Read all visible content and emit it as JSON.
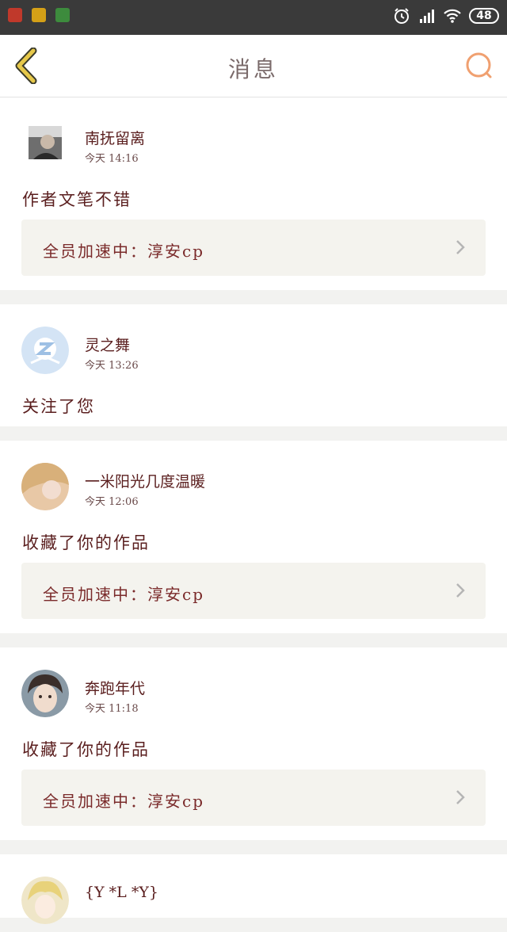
{
  "status_bar": {
    "battery": "48"
  },
  "header": {
    "title": "消息"
  },
  "messages": [
    {
      "name": "南抚留离",
      "time": "今天 14:16",
      "action": "作者文笔不错",
      "work": "全员加速中：淳安cp"
    },
    {
      "name": "灵之舞",
      "time": "今天 13:26",
      "action": "关注了您"
    },
    {
      "name": "一米阳光几度温暖",
      "time": "今天 12:06",
      "action": "收藏了你的作品",
      "work": "全员加速中：淳安cp"
    },
    {
      "name": "奔跑年代",
      "time": "今天 11:18",
      "action": "收藏了你的作品",
      "work": "全员加速中：淳安cp"
    },
    {
      "name": "{Y *L *Y}"
    }
  ],
  "colors": {
    "accent": "#f0a070",
    "back_icon": "#d4b43a",
    "text": "#5a1e1e"
  },
  "icons": {
    "back": "back-chevron-icon",
    "search": "search-icon",
    "alarm": "alarm-icon",
    "signal": "signal-icon",
    "wifi": "wifi-icon"
  }
}
